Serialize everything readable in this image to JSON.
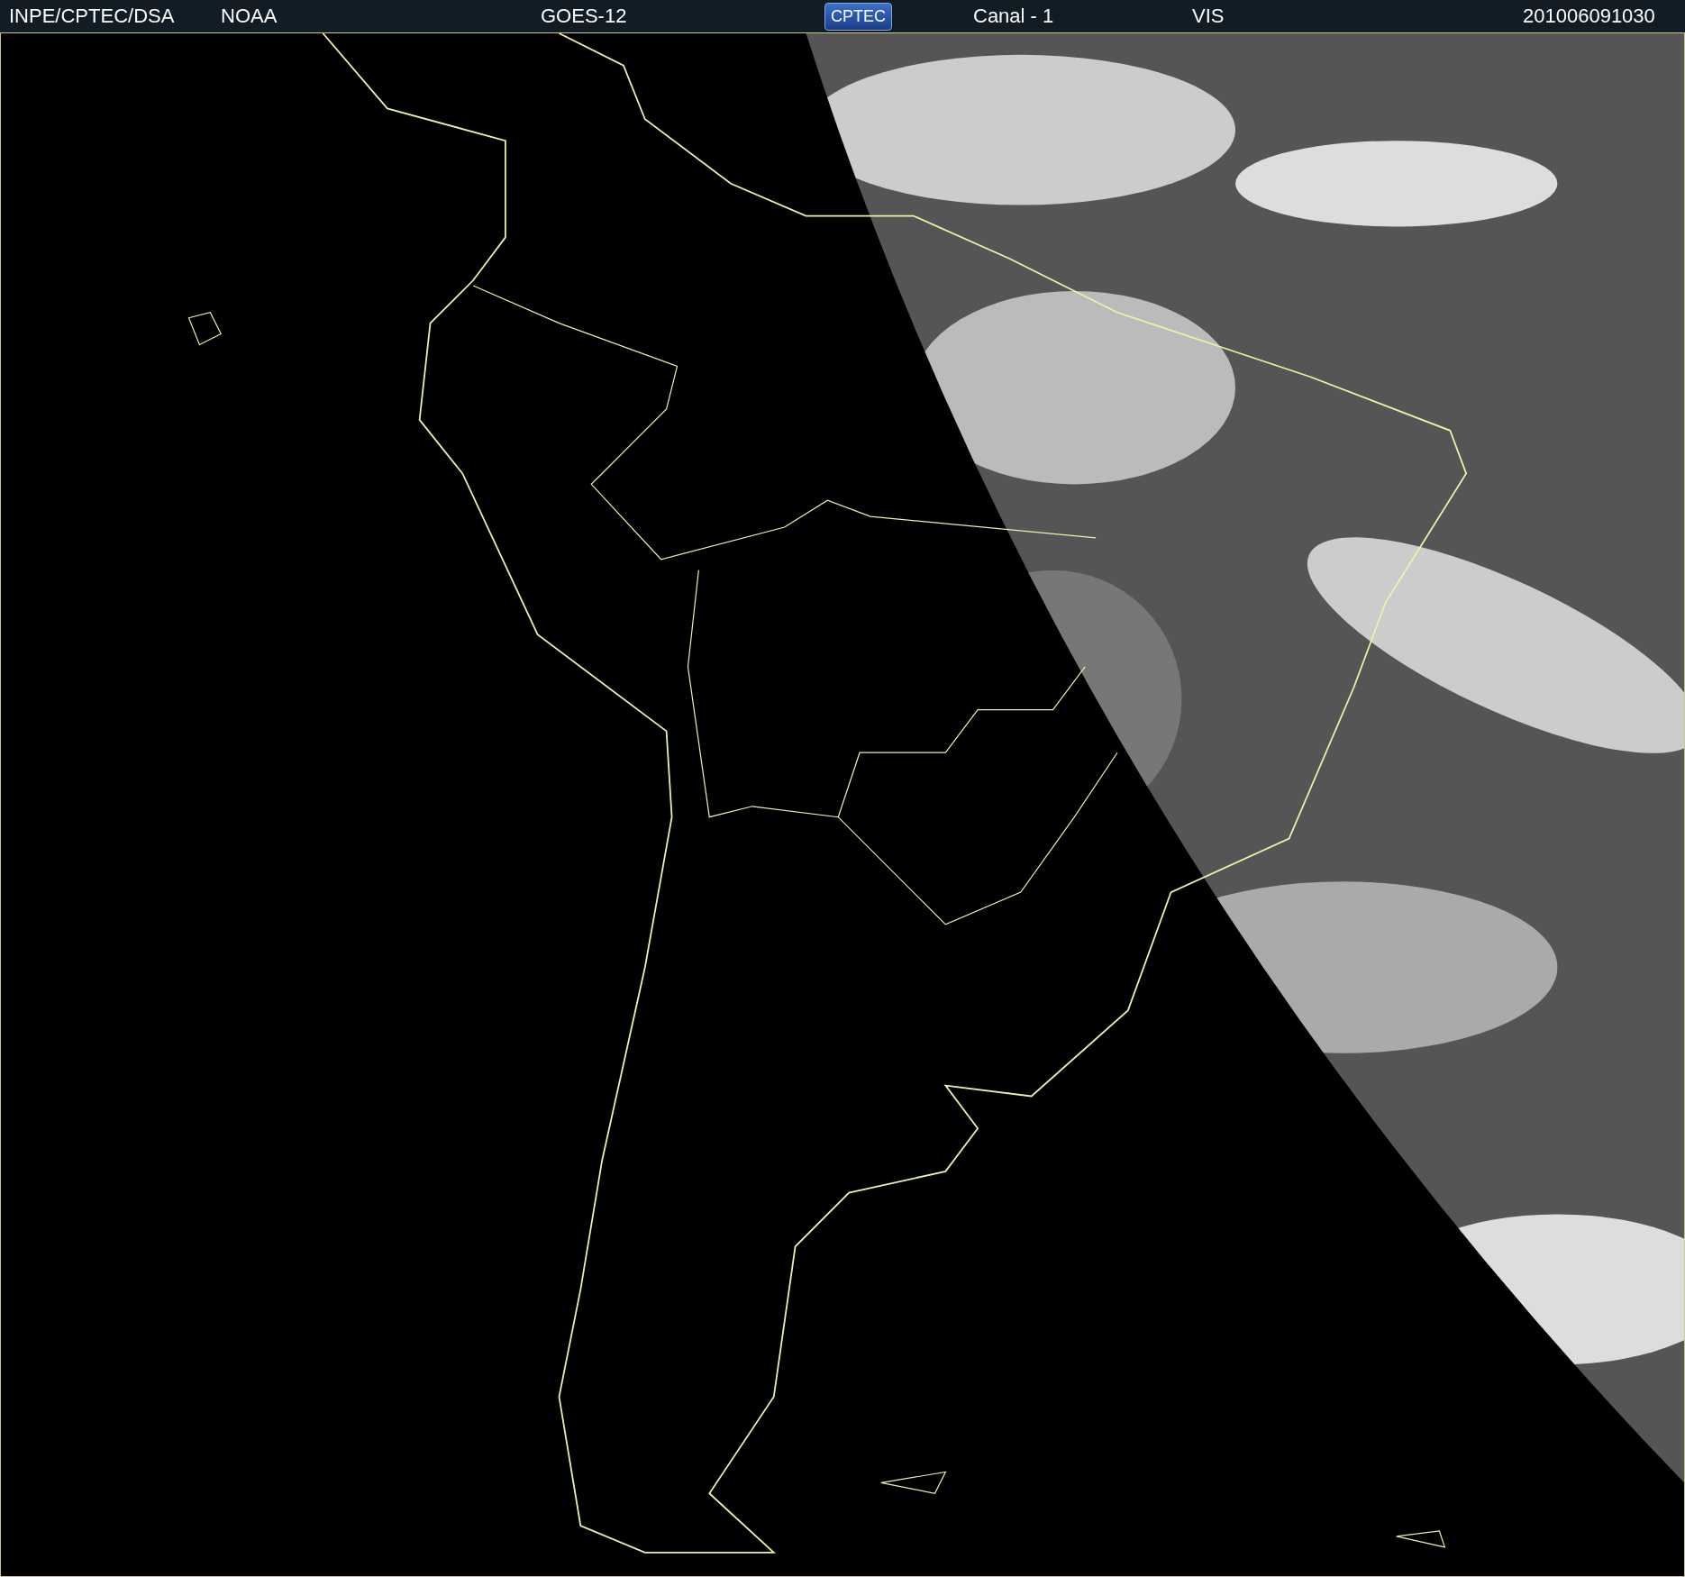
{
  "header": {
    "items": [
      {
        "kind": "text",
        "label": "INPE/CPTEC/DSA"
      },
      {
        "kind": "text",
        "label": "NOAA"
      },
      {
        "kind": "text",
        "label": "GOES-12"
      },
      {
        "kind": "logo",
        "label": "CPTEC"
      },
      {
        "kind": "text",
        "label": "Canal - 1"
      },
      {
        "kind": "text",
        "label": "VIS"
      },
      {
        "kind": "text",
        "label": "201006091030"
      }
    ]
  }
}
